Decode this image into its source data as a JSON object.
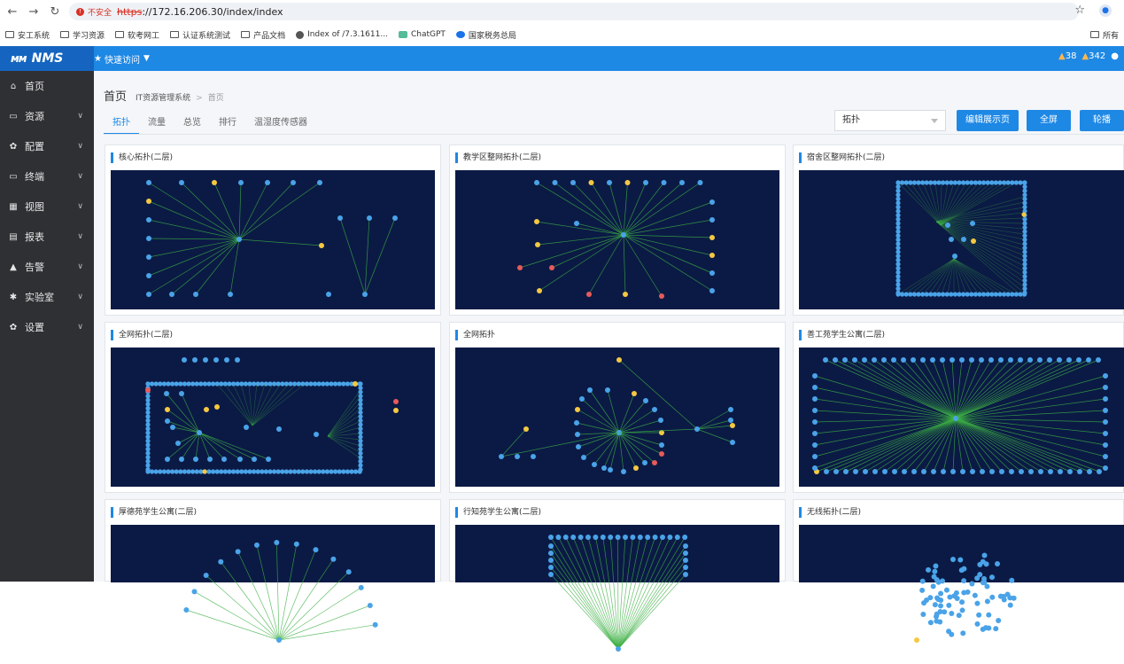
{
  "browser": {
    "security_label": "不安全",
    "url_scheme": "https",
    "url_rest": "://172.16.206.30/index/index",
    "bookmarks": [
      "安工系统",
      "学习资源",
      "软考网工",
      "认证系统测试",
      "产品文档",
      "Index of /7.3.1611...",
      "ChatGPT",
      "国家税务总局"
    ],
    "bookmarks_right": "所有"
  },
  "app": {
    "logo_text": "NMS",
    "quick_access": "快速访问",
    "alert_count_1": "38",
    "alert_count_2": "342"
  },
  "sidebar": {
    "items": [
      {
        "label": "首页",
        "icon": "home-icon"
      },
      {
        "label": "资源",
        "icon": "monitor-icon"
      },
      {
        "label": "配置",
        "icon": "gear-icon"
      },
      {
        "label": "终端",
        "icon": "desktop-icon"
      },
      {
        "label": "视图",
        "icon": "grid-icon"
      },
      {
        "label": "报表",
        "icon": "report-icon"
      },
      {
        "label": "告警",
        "icon": "warning-icon"
      },
      {
        "label": "实验室",
        "icon": "bulb-icon"
      },
      {
        "label": "设置",
        "icon": "gear-icon"
      }
    ]
  },
  "page": {
    "title": "首页",
    "breadcrumb_1": "IT资源管理系统",
    "breadcrumb_2": "首页",
    "tabs": [
      "拓扑",
      "流量",
      "总览",
      "排行",
      "温湿度传感器"
    ],
    "active_tab": "拓扑",
    "select_value": "拓扑",
    "btn_edit": "编辑展示页",
    "btn_full": "全屏",
    "btn_carousel": "轮播"
  },
  "cards": [
    {
      "title": "核心拓扑(二层)"
    },
    {
      "title": "教学区整网拓扑(二层)"
    },
    {
      "title": "宿舍区整网拓扑(二层)"
    },
    {
      "title": "全网拓扑(二层)"
    },
    {
      "title": "全网拓扑"
    },
    {
      "title": "善工苑学生公寓(二层)"
    },
    {
      "title": "厚德苑学生公寓(二层)"
    },
    {
      "title": "行知苑学生公寓(二层)"
    },
    {
      "title": "无线拓扑(二层)"
    }
  ],
  "colors": {
    "brand": "#1e88e5",
    "node_blue": "#4aa3e8",
    "node_yellow": "#f5c842",
    "node_red": "#e85a5a",
    "link_green": "#3cb043",
    "topo_bg": "#0b1a45"
  }
}
